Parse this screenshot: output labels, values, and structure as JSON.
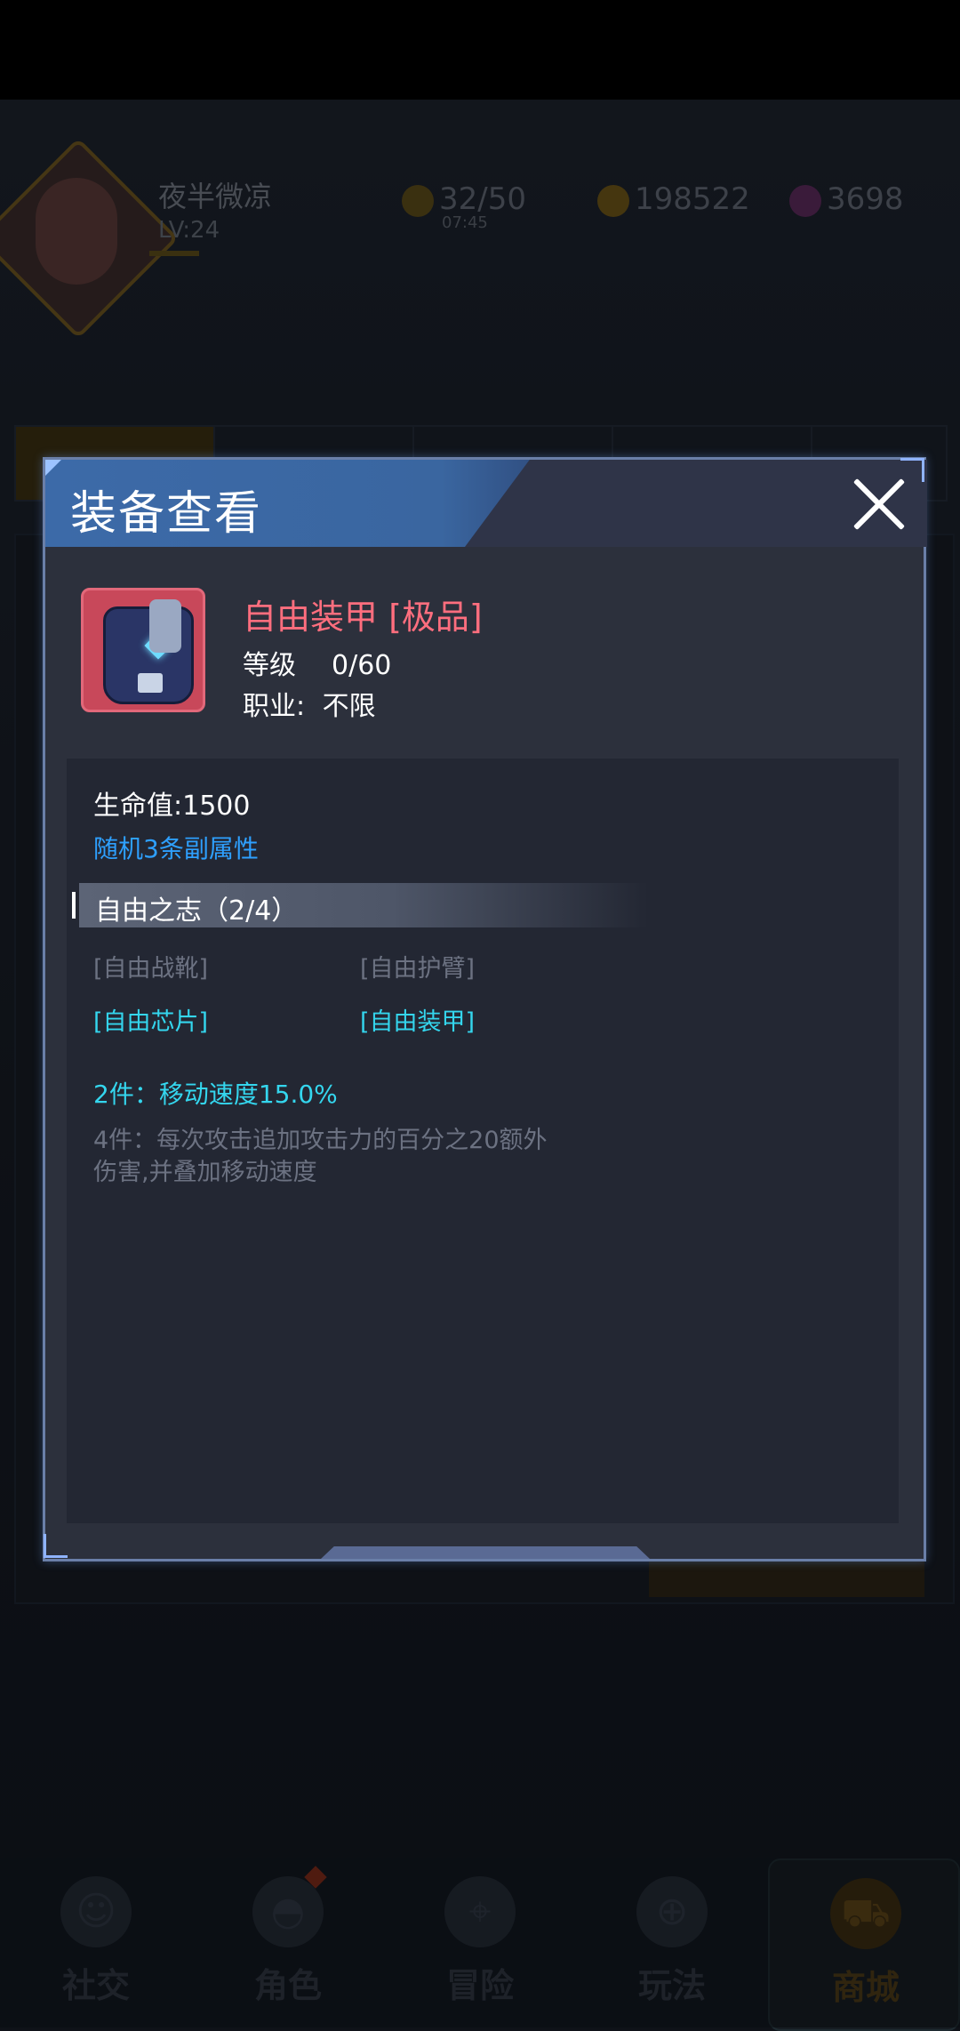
{
  "player": {
    "name": "夜半微凉",
    "level": "LV:24"
  },
  "resources": {
    "energy": "32/50",
    "energy_timer": "07:45",
    "gold": "198522",
    "gems": "3698"
  },
  "bottom_nav": [
    {
      "label": "社交",
      "icon": "social-icon"
    },
    {
      "label": "角色",
      "icon": "helmet-icon"
    },
    {
      "label": "冒险",
      "icon": "map-pin-icon"
    },
    {
      "label": "玩法",
      "icon": "gamepad-icon"
    },
    {
      "label": "商城",
      "icon": "cart-icon"
    }
  ],
  "modal": {
    "title": "装备查看",
    "item": {
      "name": "自由装甲 [极品]",
      "level_label": "等级",
      "level_value": "0/60",
      "class_label": "职业:",
      "class_value": "不限"
    },
    "stats": {
      "hp": "生命值:1500",
      "random_attributes": "随机3条副属性"
    },
    "set": {
      "title": "自由之志（2/4）",
      "pieces": [
        {
          "name": "[自由战靴]",
          "owned": false
        },
        {
          "name": "[自由护臂]",
          "owned": false
        },
        {
          "name": "[自由芯片]",
          "owned": true
        },
        {
          "name": "[自由装甲]",
          "owned": true
        }
      ],
      "bonus_2": "2件：移动速度15.0%",
      "bonus_4": "4件：每次攻击追加攻击力的百分之20额外伤害,并叠加移动速度"
    }
  },
  "colors": {
    "item_name": "#ff6e7e",
    "set_active": "#34d6ee",
    "random_attr": "#2ea0ff",
    "inactive": "#6c7282",
    "header_blue": "#3c6aa8"
  }
}
